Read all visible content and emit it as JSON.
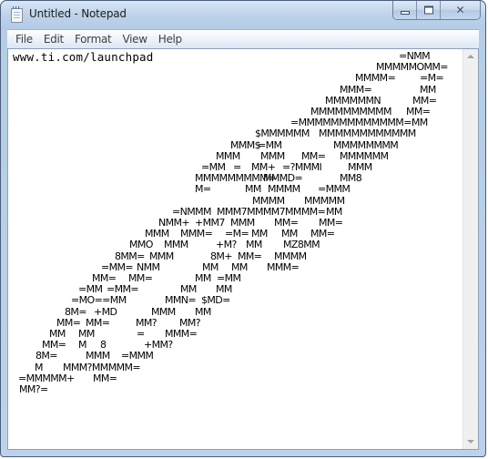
{
  "window": {
    "title": "Untitled - Notepad",
    "icon": "notepad-icon",
    "controls": {
      "minimize": "minimize-icon",
      "maximize": "maximize-icon",
      "close": "✕"
    }
  },
  "menubar": {
    "items": [
      "File",
      "Edit",
      "Format",
      "View",
      "Help"
    ]
  },
  "editor": {
    "first_line": "www.ti.com/launchpad",
    "ascii_art_lines": [
      [
        "=NMM"
      ],
      [
        "MMMMMOMM="
      ],
      [
        "MMMM=",
        "=M="
      ],
      [
        "MMM=",
        "MM"
      ],
      [
        "MMMMMMN",
        "MM="
      ],
      [
        "MMMMMMMMMM",
        "MM="
      ],
      [
        "=MMMMMMMMMMMMM=MM"
      ],
      [
        "$MMMMMM",
        "MMMMMMMMMMMM"
      ],
      [
        "MMM$",
        "=MM",
        "MMMMMMMM"
      ],
      [
        "MMM",
        "MMM",
        "MM=",
        "MMMMMM"
      ],
      [
        "=MM",
        "=",
        "MM+",
        "=?MMMI",
        "MMM"
      ],
      [
        "MMMMMMMMM=",
        "MMMD=",
        "MM8"
      ],
      [
        "M=",
        "MM",
        "MMMM",
        "=MMM"
      ],
      [
        "MMMM",
        "MMMMM"
      ],
      [
        "=NMMM",
        "MMM7MMMM7MMMM=",
        "MM"
      ],
      [
        "NMM+",
        "+MM7",
        "MMM",
        "MM=",
        "MM="
      ],
      [
        "MMM",
        "MMM=",
        "=M=",
        "MM",
        "MM",
        "MM="
      ],
      [
        "MMO",
        "MMM",
        "+M?",
        "MM",
        "MZ8MM"
      ],
      [
        "8MM=",
        "MMM",
        "8M+",
        "MM=",
        "MMMM"
      ],
      [
        "=MM=",
        "NMM",
        "MM",
        "MM",
        "MMM="
      ],
      [
        "MM=",
        "MM=",
        "MM",
        "=MM"
      ],
      [
        "=MM",
        "=MM=",
        "MM",
        "MM"
      ],
      [
        "=MO==MM",
        "MMN=",
        "$MD="
      ],
      [
        "8M=",
        "+MD",
        "MMM",
        "MM"
      ],
      [
        "MM=",
        "MM=",
        "MM?",
        "MM?"
      ],
      [
        "MM",
        "MM",
        "=",
        "MMM="
      ],
      [
        "MM=",
        "M",
        "8",
        "+MM?"
      ],
      [
        "8M=",
        "MMM",
        "=MMM"
      ],
      [
        "M",
        "MMM?MMMMM="
      ],
      [
        "=MMMMM+",
        "MM="
      ],
      [
        "MM?="
      ]
    ]
  },
  "scrollbar": {
    "up": "scroll-up-arrow-icon",
    "down": "scroll-down-arrow-icon"
  }
}
